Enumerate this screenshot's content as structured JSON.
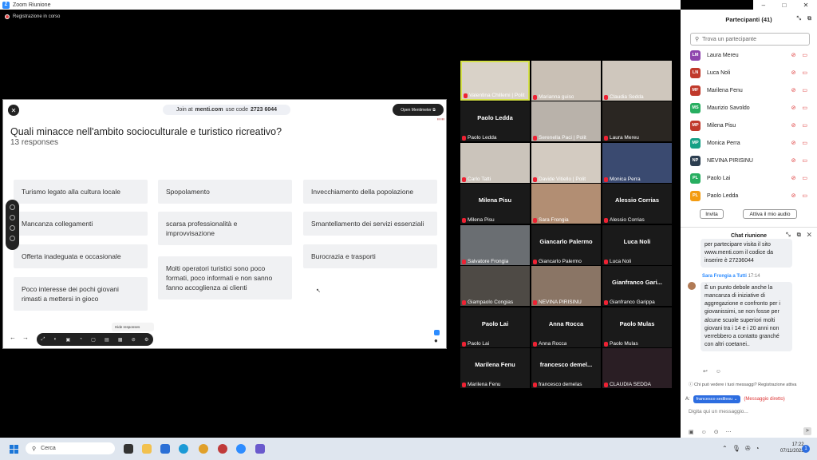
{
  "window": {
    "title": "Zoom Riunione",
    "controls": [
      "–",
      "□",
      "✕"
    ]
  },
  "recording": {
    "label": "Registrazione in corso"
  },
  "share": {
    "join_prefix": "Join at",
    "join_site": "menti.com",
    "join_code_label": "use code",
    "join_code": "2723 6044",
    "open_label": "Open Mentimeter",
    "question": "Quali minacce nell'ambito socioculturale e turistico ricreativo?",
    "responses": "13 responses",
    "hide_responses": "Hide responses",
    "cards": [
      "Turismo legato alla cultura locale",
      "Mancanza collegamenti",
      "Offerta inadeguata e occasionale",
      "Poco interesse dei pochi giovani rimasti a mettersi in gioco",
      "Spopolamento",
      "scarsa professionalità e improvvisazione",
      "Molti operatori turistici sono poco formati, poco informati e non sanno fanno accoglienza ai clienti",
      "Invecchiamento della popolazione",
      "Smantellamento dei servizi essenziali",
      "Burocrazia e trasporti"
    ]
  },
  "gallery": [
    {
      "label": "Valentina Chillemi | Polit",
      "big": "",
      "img": true,
      "color": "#d9d2c8",
      "active": true
    },
    {
      "label": "Marianna guiso",
      "big": "",
      "img": true,
      "color": "#c9c0b5"
    },
    {
      "label": "Claudia Sedda",
      "big": "",
      "img": true,
      "color": "#cfc7bd"
    },
    {
      "label": "Paolo Ledda",
      "big": "Paolo Ledda"
    },
    {
      "label": "Serenella Paci | Polit",
      "big": "",
      "img": true,
      "color": "#b9b2aa"
    },
    {
      "label": "Laura Mereu",
      "big": "",
      "img": true,
      "color": "#2a2622"
    },
    {
      "label": "Carlo Tatti",
      "big": "",
      "img": true,
      "color": "#cbc4bb"
    },
    {
      "label": "Davide Vitiello | Polit",
      "big": "",
      "img": true,
      "color": "#d3cbc1"
    },
    {
      "label": "Monica Perra",
      "big": "",
      "img": true,
      "color": "#3a4a70"
    },
    {
      "label": "Milena Pisu",
      "big": "Milena Pisu"
    },
    {
      "label": "Sara Frongia",
      "big": "",
      "img": true,
      "color": "#b28e73"
    },
    {
      "label": "Alessio Corrias",
      "big": "Alessio Corrias"
    },
    {
      "label": "Salvatore Frongia",
      "big": "",
      "img": true,
      "color": "#6a6e72"
    },
    {
      "label": "Giancarlo Palermo",
      "big": "Giancarlo Palermo"
    },
    {
      "label": "Luca Noli",
      "big": "Luca Noli"
    },
    {
      "label": "Giampaolo Congias",
      "big": "",
      "img": true,
      "color": "#4e4a45"
    },
    {
      "label": "NEVINA PIRISINU",
      "big": "",
      "img": true,
      "color": "#8a7565"
    },
    {
      "label": "Gianfranco Garippa",
      "big": "Gianfranco  Gari..."
    },
    {
      "label": "Paolo Lai",
      "big": "Paolo Lai"
    },
    {
      "label": "Anna Rocca",
      "big": "Anna Rocca"
    },
    {
      "label": "Paolo Mulas",
      "big": "Paolo Mulas"
    },
    {
      "label": "Marilena Fenu",
      "big": "Marilena Fenu"
    },
    {
      "label": "francesco demelas",
      "big": "francesco  demel..."
    },
    {
      "label": "CLAUDIA SEDDA",
      "big": "",
      "img": true,
      "color": "#2a1e24"
    }
  ],
  "participants": {
    "title": "Partecipanti (41)",
    "search_placeholder": "Trova un partecipante",
    "list": [
      {
        "initials": "LM",
        "name": "Laura Mereu",
        "color": "#8e44ad"
      },
      {
        "initials": "LN",
        "name": "Luca Noli",
        "color": "#c0392b"
      },
      {
        "initials": "MF",
        "name": "Marilena Fenu",
        "color": "#c0392b"
      },
      {
        "initials": "MS",
        "name": "Maurizio Savoldo",
        "color": "#27ae60"
      },
      {
        "initials": "MP",
        "name": "Milena Pisu",
        "color": "#c0392b"
      },
      {
        "initials": "MP",
        "name": "Monica Perra",
        "color": "#16a085"
      },
      {
        "initials": "NP",
        "name": "NEVINA PIRISINU",
        "color": "#2c3e50"
      },
      {
        "initials": "PL",
        "name": "Paolo Lai",
        "color": "#27ae60"
      },
      {
        "initials": "PL",
        "name": "Paolo Ledda",
        "color": "#f39c12"
      }
    ],
    "invite_label": "Invita",
    "audio_label": "Attiva il mio audio"
  },
  "chat": {
    "title": "Chat riunione",
    "msg1": "per partecipare visita il sito www.menti.com il codice da inserire è 27236044",
    "sender": "Sara Frongia a Tutti",
    "time": "17:14",
    "msg2": "È un punto debole anche la mancanza di iniziative di aggregazione e confronto per i giovanissimi, se non fosse per alcune scuole superiori molti giovani tra i 14 e i 20 anni non verrebbero a contatto granché con altri coetanei..",
    "note": "Chi può vedere i tuoi messaggi? Registrazione attiva",
    "to_label": "A:",
    "recipient": "francesco sedilesu",
    "dm_label": "(Messaggio diretto)",
    "input_placeholder": "Digita qui un messaggio..."
  },
  "taskbar": {
    "search": "Cerca",
    "time": "17:22",
    "date": "07/11/2023",
    "notifications": "1"
  }
}
